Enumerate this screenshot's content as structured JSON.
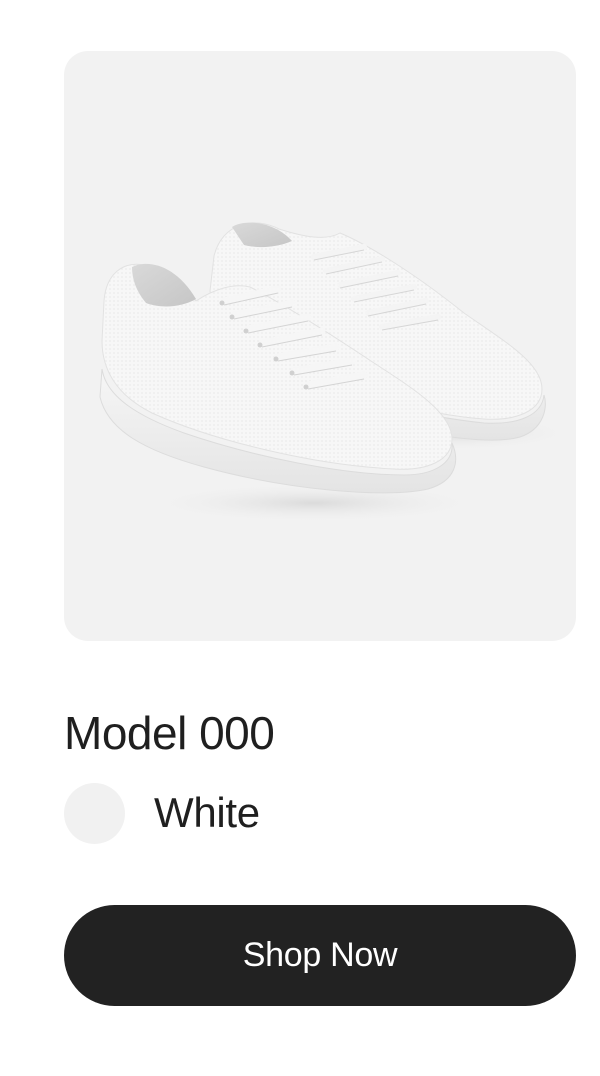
{
  "product": {
    "name": "Model 000",
    "image_icon": "white-knit-sneakers-image"
  },
  "color": {
    "name": "White",
    "swatch_hex": "#f1f1f1"
  },
  "cta": {
    "label": "Shop Now"
  },
  "colors": {
    "image_background": "#f2f2f2",
    "button_background": "#222222",
    "button_text": "#ffffff",
    "text": "#1f1f1f"
  }
}
